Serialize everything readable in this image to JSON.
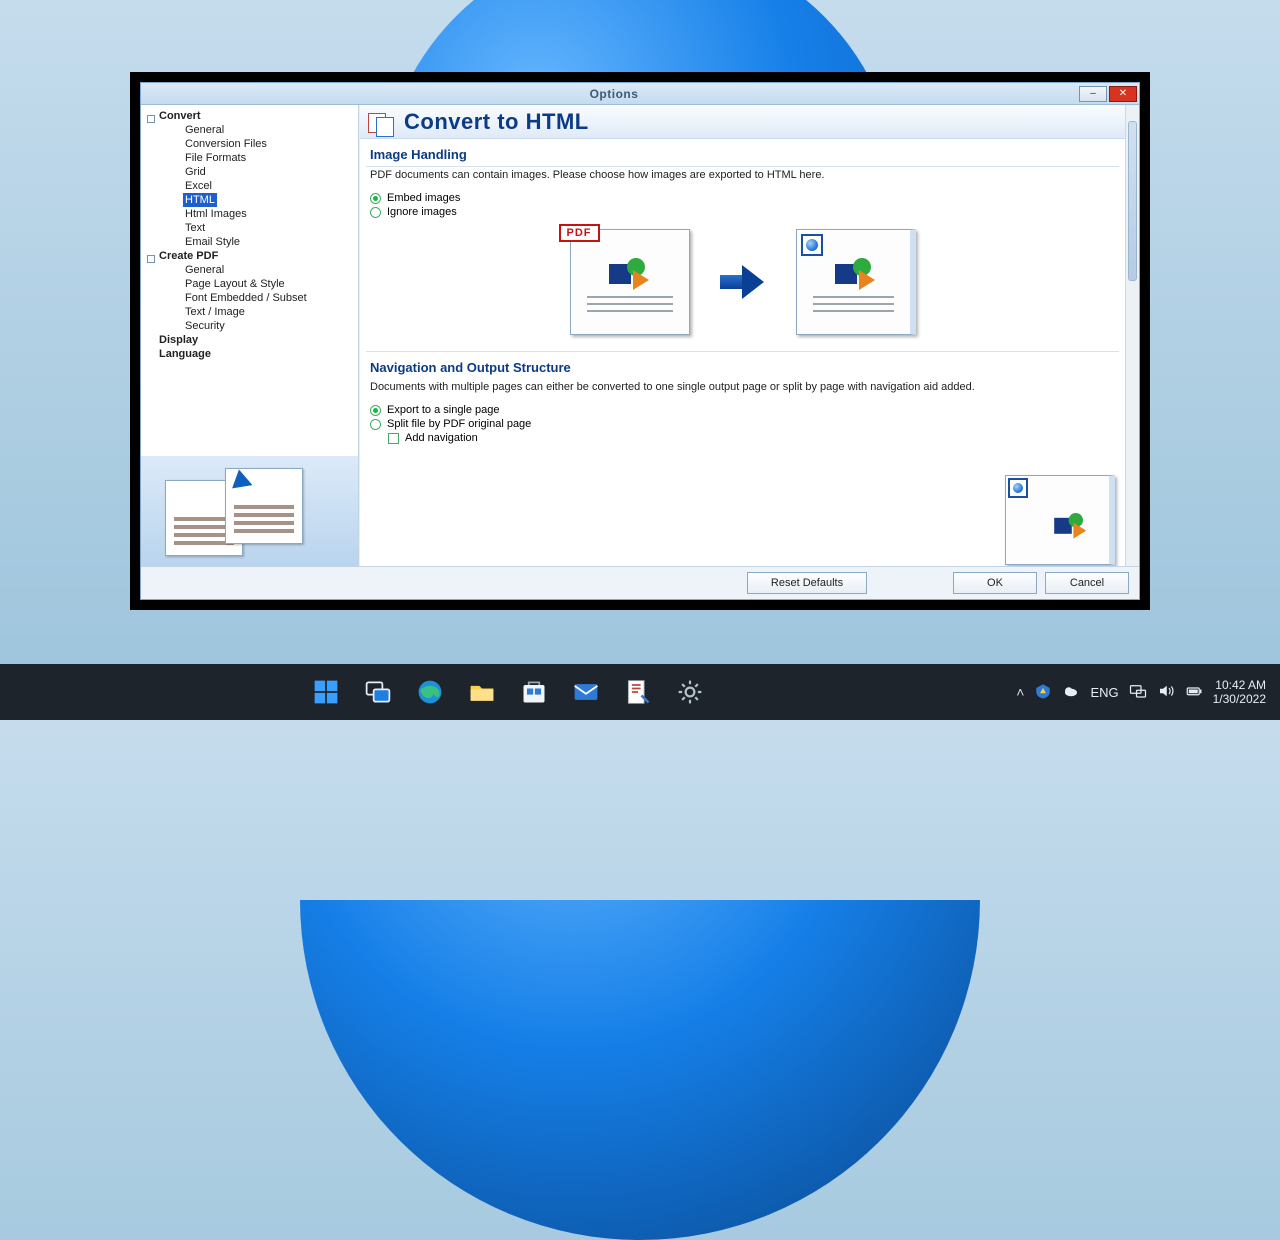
{
  "titlebar": {
    "title": "Options"
  },
  "tree": {
    "root1": "Convert",
    "root1_items": [
      "General",
      "Conversion Files",
      "File Formats",
      "Grid",
      "Excel",
      "HTML",
      "Html Images",
      "Text",
      "Email Style"
    ],
    "root1_selected_index": 5,
    "root2": "Create PDF",
    "root2_items": [
      "General",
      "Page Layout & Style",
      "Font Embedded / Subset",
      "Text / Image",
      "Security"
    ],
    "plain": [
      "Display",
      "Language"
    ]
  },
  "page": {
    "heading": "Convert to HTML",
    "sec1_title": "Image Handling",
    "sec1_desc": "PDF documents can contain images. Please choose how images are exported to HTML here.",
    "opt_embed": "Embed images",
    "opt_ignore": "Ignore images",
    "sec2_title": "Navigation and Output Structure",
    "sec2_desc": "Documents with multiple pages can either be converted to one single output page or split by page with navigation aid added.",
    "opt_single": "Export to a single page",
    "opt_split": "Split file by PDF original page",
    "opt_nav": "Add navigation"
  },
  "buttons": {
    "reset": "Reset Defaults",
    "ok": "OK",
    "cancel": "Cancel"
  },
  "tray": {
    "lang": "ENG",
    "time": "10:42 AM",
    "date": "1/30/2022"
  },
  "colors": {
    "accent": "#0b3b86",
    "danger": "#d83321"
  }
}
